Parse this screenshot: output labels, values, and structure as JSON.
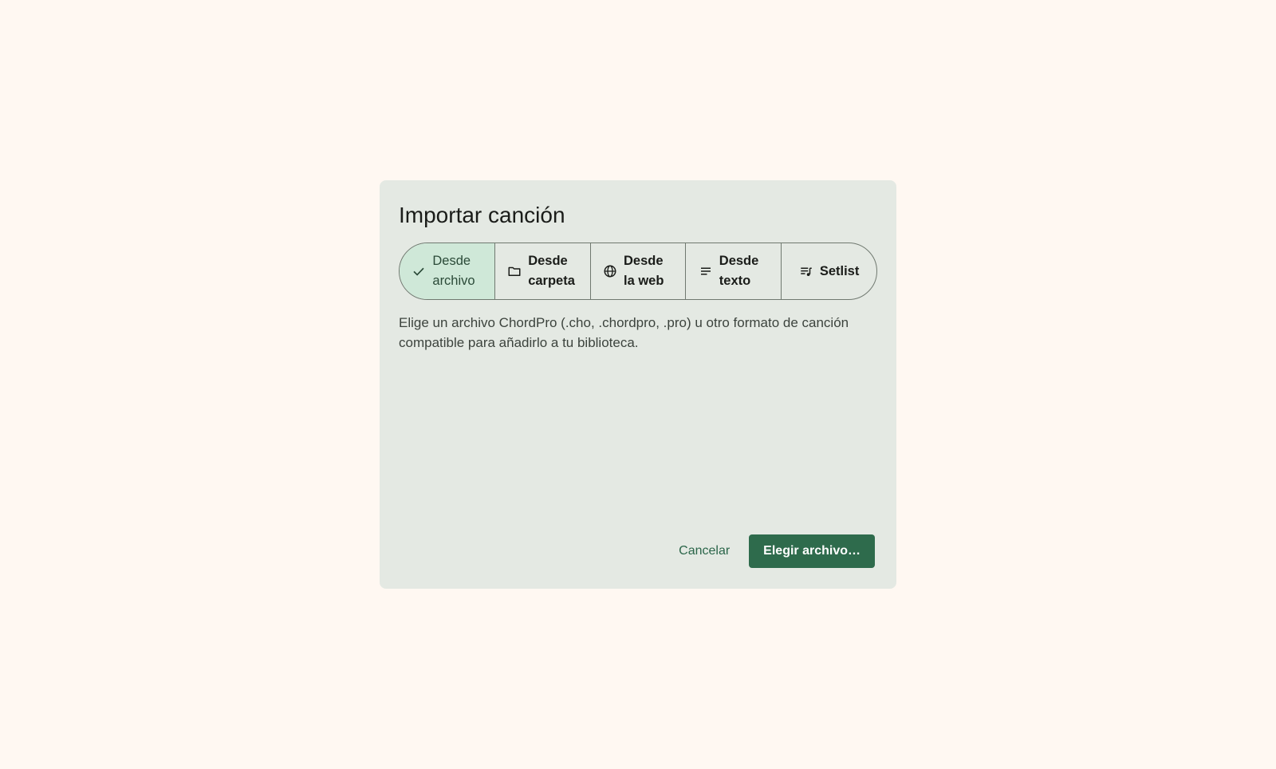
{
  "dialog": {
    "title": "Importar canción",
    "description": "Elige un archivo ChordPro (.cho, .chordpro, .pro) u otro formato de canción compatible para añadirlo a tu biblioteca.",
    "cancel_label": "Cancelar",
    "confirm_label": "Elegir archivo…"
  },
  "tabs": [
    {
      "label": "Desde archivo",
      "icon": "check-icon",
      "selected": true
    },
    {
      "label": "Desde carpeta",
      "icon": "folder-icon",
      "selected": false
    },
    {
      "label": "Desde la web",
      "icon": "globe-icon",
      "selected": false
    },
    {
      "label": "Desde texto",
      "icon": "text-lines-icon",
      "selected": false
    },
    {
      "label": "Setlist",
      "icon": "queue-music-icon",
      "selected": false
    }
  ],
  "colors": {
    "background": "#fff8f2",
    "dialog": "#e4e9e3",
    "selected_segment": "#cfe8d8",
    "primary": "#2e6b4c"
  }
}
